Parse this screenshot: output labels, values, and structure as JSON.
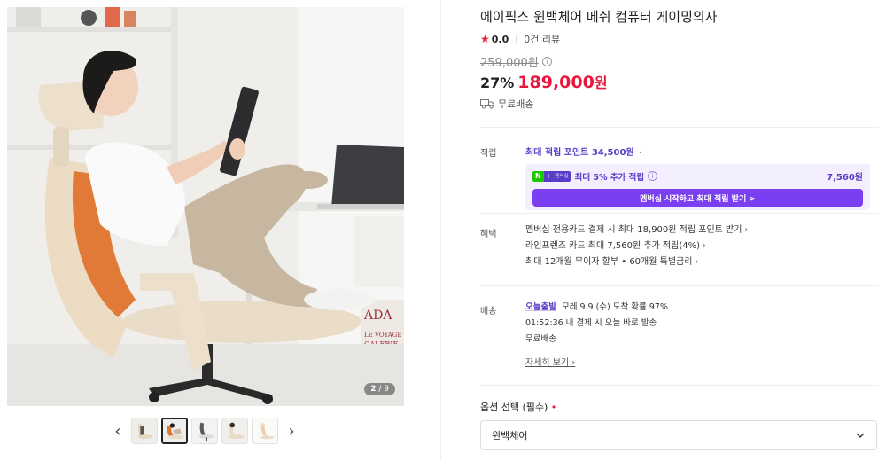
{
  "product": {
    "title": "에이픽스 윈백체어 메쉬 컴퓨터 게이밍의자",
    "rating": "0.0",
    "review_count": "0건 리뷰",
    "original_price": "259,000원",
    "discount": "27%",
    "sale_price": "189,000",
    "sale_unit": "원",
    "shipping_tag": "무료배송"
  },
  "gallery": {
    "current": "2",
    "total": "/ 9",
    "prev_label": "‹",
    "next_label": "›",
    "thumbnail_count": 5,
    "active_thumbnail": 2
  },
  "points": {
    "label": "적립",
    "max_points": "최대 적립 포인트 34,500원",
    "member_badge": "멤버십",
    "member_text": "최대 5% 추가 적립",
    "member_amount": "7,560원",
    "member_button": "멤버십 시작하고 최대 적립 받기 >"
  },
  "benefits": {
    "label": "혜택",
    "items": [
      "멤버십 전용카드 결제 시 최대 18,900원 적립 포인트 받기",
      "라인프렌즈 카드 최대 7,560원 추가 적립(4%)",
      "최대 12개월 무이자 할부 • 60개월 특별금리"
    ]
  },
  "delivery": {
    "label": "배송",
    "today_tag": "오늘출발",
    "arrival": "모레 9.9.(수) 도착 확률 97%",
    "cutoff": "01:52:36  내 결제 시 오늘 바로 발송",
    "fee": "무료배송",
    "more_link": "자세히 보기"
  },
  "option": {
    "label": "옵션 선택 (필수)",
    "required_mark": "•",
    "selected": "윈백체어"
  },
  "colors": {
    "sale_red": "#e8183c",
    "point_purple": "#5a3cc8",
    "button_purple": "#7b3ff2",
    "member_bg": "#f3efff",
    "naver_green": "#1ec800"
  },
  "icons": [
    "star-icon",
    "info-icon",
    "truck-icon",
    "chevron-down-icon",
    "chevron-right-icon",
    "prev-arrow-icon",
    "next-arrow-icon"
  ]
}
